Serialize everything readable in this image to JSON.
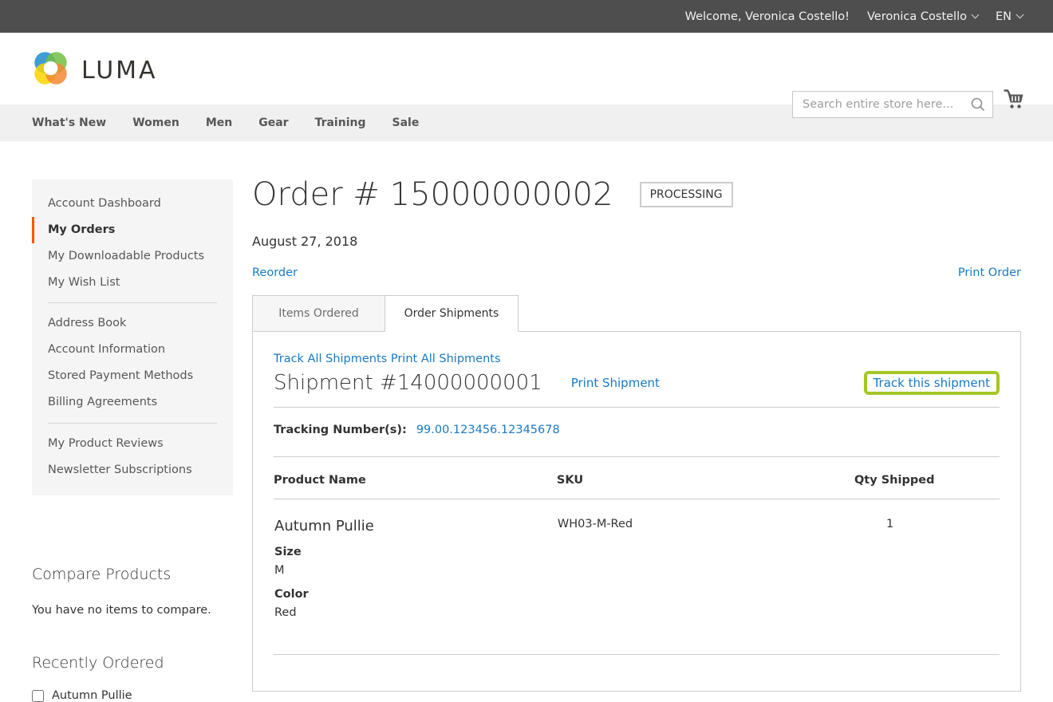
{
  "topbar": {
    "welcome": "Welcome, Veronica Costello!",
    "account_menu": "Veronica Costello",
    "language": "EN"
  },
  "header": {
    "logo_text": "LUMA",
    "search_placeholder": "Search entire store here...",
    "icons": [
      "luma-logo-icon",
      "search-icon",
      "cart-icon"
    ]
  },
  "nav": {
    "items": [
      {
        "label": "What's New"
      },
      {
        "label": "Women"
      },
      {
        "label": "Men"
      },
      {
        "label": "Gear"
      },
      {
        "label": "Training"
      },
      {
        "label": "Sale"
      }
    ]
  },
  "sidebar": {
    "groups": [
      {
        "items": [
          {
            "label": "Account Dashboard",
            "active": false
          },
          {
            "label": "My Orders",
            "active": true
          },
          {
            "label": "My Downloadable Products",
            "active": false
          },
          {
            "label": "My Wish List",
            "active": false
          }
        ]
      },
      {
        "items": [
          {
            "label": "Address Book",
            "active": false
          },
          {
            "label": "Account Information",
            "active": false
          },
          {
            "label": "Stored Payment Methods",
            "active": false
          },
          {
            "label": "Billing Agreements",
            "active": false
          }
        ]
      },
      {
        "items": [
          {
            "label": "My Product Reviews",
            "active": false
          },
          {
            "label": "Newsletter Subscriptions",
            "active": false
          }
        ]
      }
    ],
    "compare": {
      "title": "Compare Products",
      "empty_text": "You have no items to compare."
    },
    "recent": {
      "title": "Recently Ordered",
      "items": [
        {
          "label": "Autumn Pullie",
          "checked": false
        }
      ]
    }
  },
  "main": {
    "title": "Order # 15000000002",
    "status": "PROCESSING",
    "date": "August 27, 2018",
    "reorder_link": "Reorder",
    "print_order_link": "Print Order",
    "tabs": [
      {
        "label": "Items Ordered",
        "active": false
      },
      {
        "label": "Order Shipments",
        "active": true
      }
    ],
    "shipments": {
      "track_all_link": "Track All Shipments",
      "print_all_link": "Print All Shipments",
      "shipment_title": "Shipment #14000000001",
      "print_shipment_link": "Print Shipment",
      "track_this_link": "Track this shipment",
      "tracking_label": "Tracking Number(s):",
      "tracking_number": "99.00.123456.12345678",
      "table": {
        "headers": [
          "Product Name",
          "SKU",
          "Qty Shipped"
        ],
        "rows": [
          {
            "product": "Autumn Pullie",
            "sku": "WH03-M-Red",
            "qty": "1",
            "options": [
              {
                "label": "Size",
                "value": "M"
              },
              {
                "label": "Color",
                "value": "Red"
              }
            ]
          }
        ]
      }
    }
  },
  "colors": {
    "topbar_bg": "#4e4e4e",
    "accent_orange": "#ff5501",
    "link_blue": "#1979c3",
    "highlight_green": "#a4c627",
    "nav_bg": "#f0f0f0",
    "sidebar_bg": "#f5f5f5",
    "border_gray": "#cccccc"
  }
}
